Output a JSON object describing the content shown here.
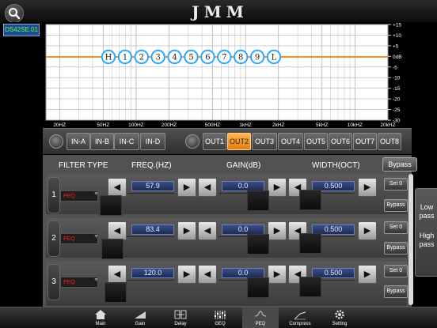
{
  "app": {
    "brand": "JMM",
    "device_label": "DS42SE.01"
  },
  "graph": {
    "x_ticks": [
      "20HZ",
      "50HZ",
      "100HZ",
      "200HZ",
      "500HZ",
      "1kHZ",
      "2kHZ",
      "5kHZ",
      "10kHZ",
      "20kHZ"
    ],
    "y_ticks": [
      "+15",
      "+10",
      "+5",
      "0dB",
      "-5",
      "-10",
      "-15",
      "-20",
      "-25",
      "-30"
    ],
    "eq_markers": [
      "H",
      "1",
      "2",
      "3",
      "4",
      "5",
      "6",
      "7",
      "8",
      "9",
      "L"
    ],
    "response_color": "#ff8c1a",
    "marker_color": "#2aa8ff"
  },
  "channels": {
    "inputs": [
      "IN-A",
      "IN-B",
      "IN-C",
      "IN-D"
    ],
    "outputs": [
      "OUT1",
      "OUT2",
      "OUT3",
      "OUT4",
      "OUT5",
      "OUT6",
      "OUT7",
      "OUT8"
    ],
    "active_output": "OUT2",
    "active_color": "#f0a030"
  },
  "table": {
    "headers": {
      "filter_type": "FILTER TYPE",
      "freq": "FREQ.(HZ)",
      "gain": "GAIN(dB)",
      "width": "WIDTH(OCT)"
    },
    "bypass_label": "Bypass",
    "rows": [
      {
        "num": "1",
        "type": "PEQ",
        "freq": "57.9",
        "gain": "0.0",
        "width": "0.500",
        "set": "Set 0",
        "bypass": "Bypass"
      },
      {
        "num": "2",
        "type": "PEQ",
        "freq": "83.4",
        "gain": "0.0",
        "width": "0.500",
        "set": "Set 0",
        "bypass": "Bypass"
      },
      {
        "num": "3",
        "type": "PEQ",
        "freq": "120.0",
        "gain": "0.0",
        "width": "0.500",
        "set": "Set 0",
        "bypass": "Bypass"
      }
    ]
  },
  "pass": {
    "low": [
      "Low",
      "pass"
    ],
    "high": [
      "High",
      "pass"
    ]
  },
  "nav": [
    {
      "label": "Main",
      "icon": "home-icon"
    },
    {
      "label": "Gain",
      "icon": "gain-icon"
    },
    {
      "label": "Delay",
      "icon": "delay-icon"
    },
    {
      "label": "GEQ",
      "icon": "geq-icon"
    },
    {
      "label": "PEQ",
      "icon": "peq-icon"
    },
    {
      "label": "Compress",
      "icon": "compress-icon"
    },
    {
      "label": "Setting",
      "icon": "gear-icon"
    }
  ],
  "active_nav": "PEQ"
}
